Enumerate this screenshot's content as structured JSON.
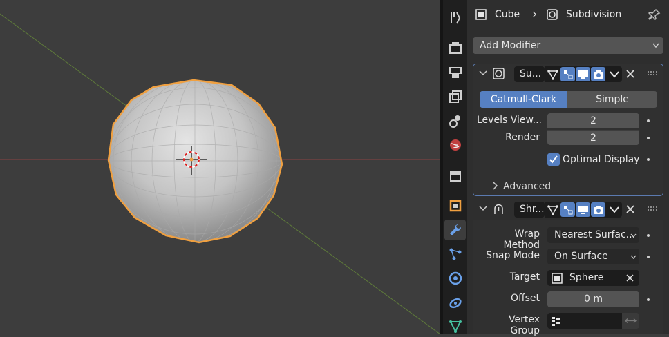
{
  "breadcrumb": {
    "object": "Cube",
    "separator": "›",
    "modifier": "Subdivision"
  },
  "add_modifier": {
    "label": "Add Modifier"
  },
  "subdivision": {
    "name": "Su...",
    "modes": [
      "Catmull-Clark",
      "Simple"
    ],
    "active_mode": "Catmull-Clark",
    "levels_viewport_label": "Levels View...",
    "levels_viewport_value": "2",
    "render_label": "Render",
    "render_value": "2",
    "optimal_display_label": "Optimal Display",
    "optimal_display_checked": true,
    "advanced_label": "Advanced"
  },
  "shrinkwrap": {
    "name": "Shr...",
    "wrap_method_label": "Wrap Method",
    "wrap_method_value": "Nearest Surfac...",
    "snap_mode_label": "Snap Mode",
    "snap_mode_value": "On Surface",
    "target_label": "Target",
    "target_value": "Sphere",
    "offset_label": "Offset",
    "offset_value": "0 m",
    "vertex_group_label": "Vertex Group",
    "vertex_group_value": ""
  },
  "tabs": [
    "tool",
    "render",
    "output",
    "view-layer",
    "scene",
    "world",
    "collection",
    "object",
    "modifiers",
    "particles",
    "physics",
    "constraints",
    "data"
  ],
  "active_tab": "modifiers",
  "colors": {
    "accent": "#5680c2",
    "selection_outline": "#f0a040",
    "panel_bg": "#2e2e2e",
    "viewport_bg": "#3d3d3d"
  }
}
